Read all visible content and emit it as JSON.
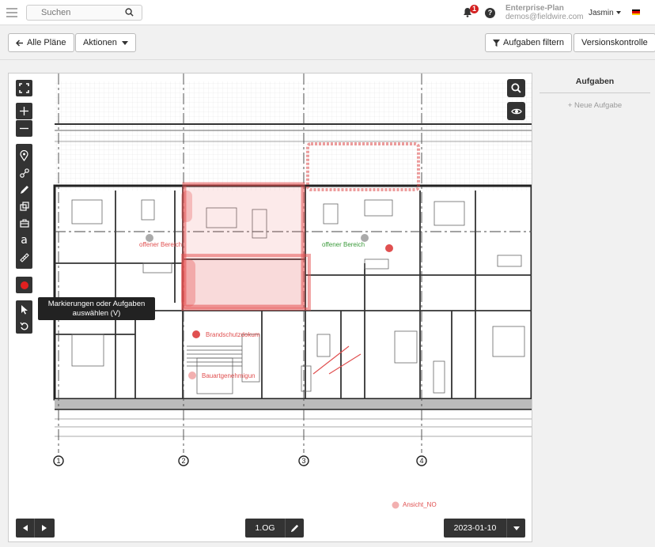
{
  "topbar": {
    "search_placeholder": "Suchen",
    "notification_count": "1",
    "plan_name": "Enterprise-Plan",
    "account_email": "demos@fieldwire.com",
    "user_name": "Jasmin",
    "language_flag": "de-flag-icon"
  },
  "toolbar": {
    "back_label": "Alle Pläne",
    "actions_label": "Aktionen",
    "filter_label": "Aufgaben filtern",
    "version_control_label": "Versionskontrolle"
  },
  "viewer": {
    "tools": [
      "expand-icon",
      "zoom-in-icon",
      "zoom-out-icon",
      "pin-icon",
      "link-icon",
      "pencil-icon",
      "shapes-icon",
      "briefcase-icon",
      "text-icon",
      "ruler-icon",
      "record-icon",
      "select-cursor-icon",
      "undo-icon"
    ],
    "tooltip": "Markierungen oder Aufgaben auswählen (V)",
    "level": "1.OG",
    "version_date": "2023-01-10",
    "annotations": {
      "area_left": "offener Bereich",
      "area_right": "offener Bereich",
      "task_fire": "Brandschutzdokum",
      "task_permit": "Bauartgenehmigun",
      "view_marker": "Ansicht_NO"
    },
    "grid_labels": [
      "1",
      "2",
      "3",
      "4"
    ],
    "accent_red": "#e05050",
    "accent_green": "#3a9a3a"
  },
  "tasks_panel": {
    "title": "Aufgaben",
    "new_task": "+ Neue Aufgabe"
  }
}
